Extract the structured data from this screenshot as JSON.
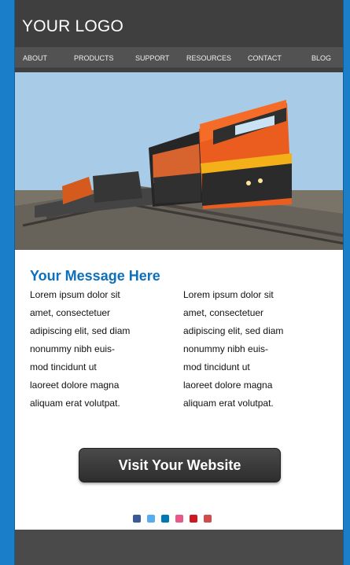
{
  "header": {
    "logo": "YOUR LOGO",
    "nav": [
      "ABOUT",
      "PRODUCTS",
      "SUPPORT",
      "RESOURCES",
      "CONTACT",
      "BLOG"
    ]
  },
  "hero": {
    "image_label": "Freight train"
  },
  "content": {
    "title": "Your Message Here",
    "left_column": [
      "Lorem ipsum dolor sit",
      "amet, consectetuer",
      "adipiscing elit, sed diam",
      "nonummy nibh euis-",
      "mod tincidunt ut",
      "laoreet dolore magna",
      "aliquam erat volutpat."
    ],
    "right_column": [
      "Lorem ipsum dolor sit",
      "amet, consectetuer",
      "adipiscing elit, sed diam",
      "nonummy nibh euis-",
      "mod tincidunt ut",
      "laoreet dolore magna",
      "aliquam erat volutpat."
    ]
  },
  "cta": {
    "label": "Visit Your Website"
  },
  "social": [
    {
      "name": "facebook-icon",
      "color": "#3b5998"
    },
    {
      "name": "twitter-icon",
      "color": "#55acee"
    },
    {
      "name": "linkedin-icon",
      "color": "#0077b5"
    },
    {
      "name": "email-icon",
      "color": "#e55a8a"
    },
    {
      "name": "youtube-icon",
      "color": "#cc181e"
    },
    {
      "name": "rss-icon",
      "color": "#d24b4b"
    }
  ]
}
